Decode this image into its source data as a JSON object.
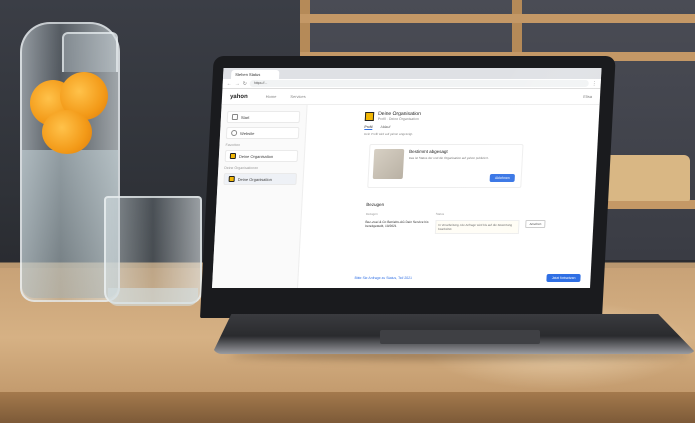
{
  "browser": {
    "tab_title": "Stehen Status",
    "url": "https://..."
  },
  "app": {
    "logo": "yahon",
    "nav": [
      "Home",
      "Services"
    ],
    "user": "Elisa"
  },
  "sidebar": {
    "items": [
      {
        "label": "Start",
        "icon": "home-icon"
      },
      {
        "label": "Website",
        "icon": "globe-icon"
      }
    ],
    "section_org": "Favoriten",
    "org_item": "Deine Organisation",
    "section_active": "Deine Organisationen",
    "active_item": "Deine Organisation"
  },
  "org": {
    "name": "Deine Organisation",
    "subtitle": "Profil · Deine Organisation",
    "tabs": [
      "Profil",
      "Ablauf"
    ],
    "note": "Dein Profil wird auf yahon angezeigt."
  },
  "promo": {
    "title": "Bestimmt abgesagt",
    "text": "Das ist Status der und die Organisation auf yahon publiziert.",
    "button": "Ablehnen"
  },
  "bestellungen": {
    "title": "Bezugen",
    "col1": "Bezugen",
    "col2": "Status",
    "row_left": "Bez-zwei & Co Betriebs-AG Dein Service bis bereitgestellt, 10/2021",
    "row_right": "In Verarbeitung. Die Anfrage wird bis auf die Bewertung bearbeitet.",
    "row_button": "Ansehen"
  },
  "footer": {
    "link": "Bitte Sie Anfrage zu Status, Teil 2021",
    "button": "Jetzt fortsetzen"
  },
  "colors": {
    "accent": "#2f6fe4",
    "org_logo": "#f2b705",
    "orange": "#f39a18"
  }
}
